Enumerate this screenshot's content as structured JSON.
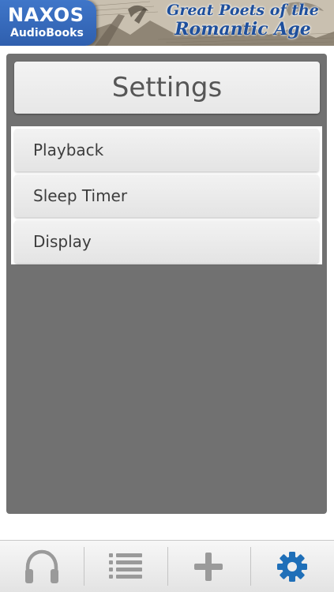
{
  "banner": {
    "logo_name": "NAXOS",
    "logo_sub": "AudioBooks",
    "title_line1": "Great Poets of the",
    "title_line2": "Romantic Age"
  },
  "settings": {
    "title": "Settings",
    "items": [
      {
        "label": "Playback"
      },
      {
        "label": "Sleep Timer"
      },
      {
        "label": "Display"
      }
    ]
  },
  "tabbar": {
    "tabs": [
      {
        "icon": "headphones-icon",
        "active": false
      },
      {
        "icon": "list-icon",
        "active": false
      },
      {
        "icon": "plus-icon",
        "active": false
      },
      {
        "icon": "gear-icon",
        "active": true
      }
    ]
  },
  "colors": {
    "accent": "#1f6fb8",
    "logo_blue": "#3a6fc4",
    "panel_gray": "#717171"
  }
}
